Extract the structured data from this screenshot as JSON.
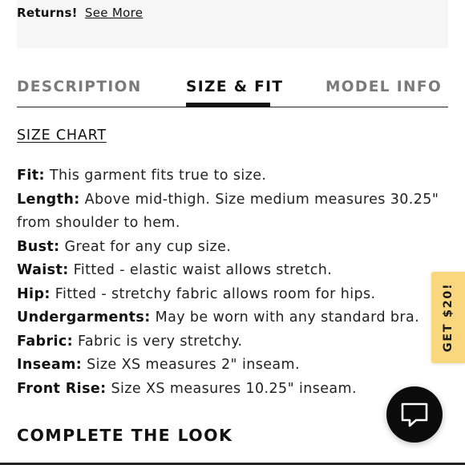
{
  "returns": {
    "label": "Returns!",
    "link": "See More"
  },
  "tabs": [
    {
      "label": "DESCRIPTION",
      "active": false
    },
    {
      "label": "SIZE & FIT",
      "active": true
    },
    {
      "label": "MODEL INFO",
      "active": false
    }
  ],
  "size_chart_link": "SIZE CHART",
  "fit_details": [
    {
      "label": "Fit:",
      "text": "This garment fits true to size."
    },
    {
      "label": "Length:",
      "text": "Above mid-thigh. Size medium measures 30.25\"",
      "text2": "from shoulder to hem."
    },
    {
      "label": "Bust:",
      "text": "Great for any cup size."
    },
    {
      "label": "Waist:",
      "text": "Fitted - elastic waist allows stretch."
    },
    {
      "label": "Hip:",
      "text": "Fitted - stretchy fabric allows room for hips."
    },
    {
      "label": "Undergarments:",
      "text": "May be worn with any standard bra."
    },
    {
      "label": "Fabric:",
      "text": "Fabric is very stretchy."
    },
    {
      "label": "Inseam:",
      "text": "Size XS measures 2\" inseam."
    },
    {
      "label": "Front Rise:",
      "text": "Size XS measures 10.25\" inseam."
    }
  ],
  "complete_look_heading": "COMPLETE THE LOOK",
  "promo": {
    "label": "GET $20!",
    "color": "#f9d77e"
  },
  "chat": {
    "icon": "chat-bubble-icon"
  }
}
